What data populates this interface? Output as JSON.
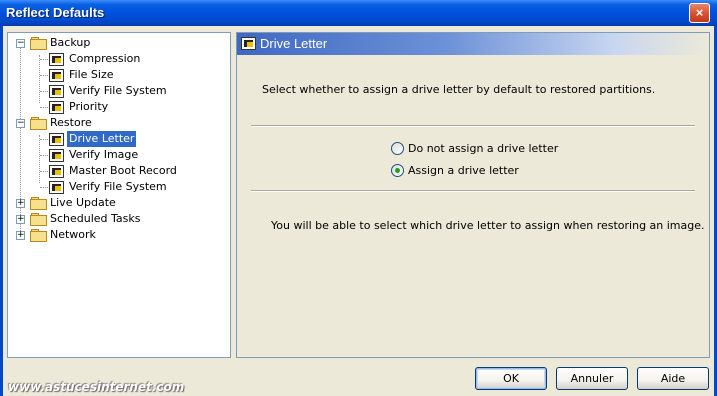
{
  "window": {
    "title": "Reflect Defaults",
    "close_label": "×"
  },
  "tree": {
    "groups": [
      {
        "label": "Backup",
        "expanded": true,
        "children": [
          "Compression",
          "File Size",
          "Verify File System",
          "Priority"
        ]
      },
      {
        "label": "Restore",
        "expanded": true,
        "children": [
          "Drive Letter",
          "Verify Image",
          "Master Boot Record",
          "Verify File System"
        ]
      },
      {
        "label": "Live Update",
        "expanded": false,
        "children": []
      },
      {
        "label": "Scheduled Tasks",
        "expanded": false,
        "children": []
      },
      {
        "label": "Network",
        "expanded": false,
        "children": []
      }
    ],
    "selected": "Drive Letter",
    "expanded_glyph": "−",
    "collapsed_glyph": "+"
  },
  "panel": {
    "title": "Drive Letter",
    "description": "Select whether to assign a drive letter by default to restored partitions.",
    "options": [
      {
        "label": "Do not assign a drive letter",
        "selected": false
      },
      {
        "label": "Assign a drive letter",
        "selected": true
      }
    ],
    "info": "You will be able to select which drive letter to assign when restoring an image."
  },
  "buttons": {
    "ok": "OK",
    "cancel": "Annuler",
    "help": "Aide"
  },
  "watermark": "www.astucesinternet.com",
  "colors": {
    "titlebar": "#0050dc",
    "selection": "#316ac5",
    "dialog_bg": "#ece9d8"
  }
}
